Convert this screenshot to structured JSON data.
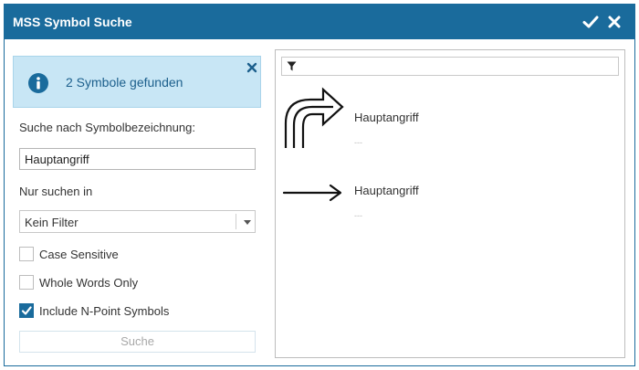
{
  "window": {
    "title": "MSS Symbol Suche"
  },
  "info_message": {
    "text": "2 Symbole gefunden"
  },
  "search": {
    "label": "Suche nach Symbolbezeichnung:",
    "value": "Hauptangriff",
    "filter_label": "Nur suchen in",
    "filter_selected": "Kein Filter"
  },
  "options": [
    {
      "label": "Case Sensitive",
      "checked": false
    },
    {
      "label": "Whole Words Only",
      "checked": false
    },
    {
      "label": "Include N-Point Symbols",
      "checked": true
    }
  ],
  "search_button": {
    "label": "Suche"
  },
  "results": [
    {
      "name": "Hauptangriff",
      "sub": "---",
      "icon": "main-attack-curved-arrow"
    },
    {
      "name": "Hauptangriff",
      "sub": "---",
      "icon": "main-attack-straight-arrow"
    }
  ],
  "colors": {
    "accent": "#1a6b9c",
    "info_bg": "#c8e6f5",
    "info_text": "#1c5f8c"
  }
}
